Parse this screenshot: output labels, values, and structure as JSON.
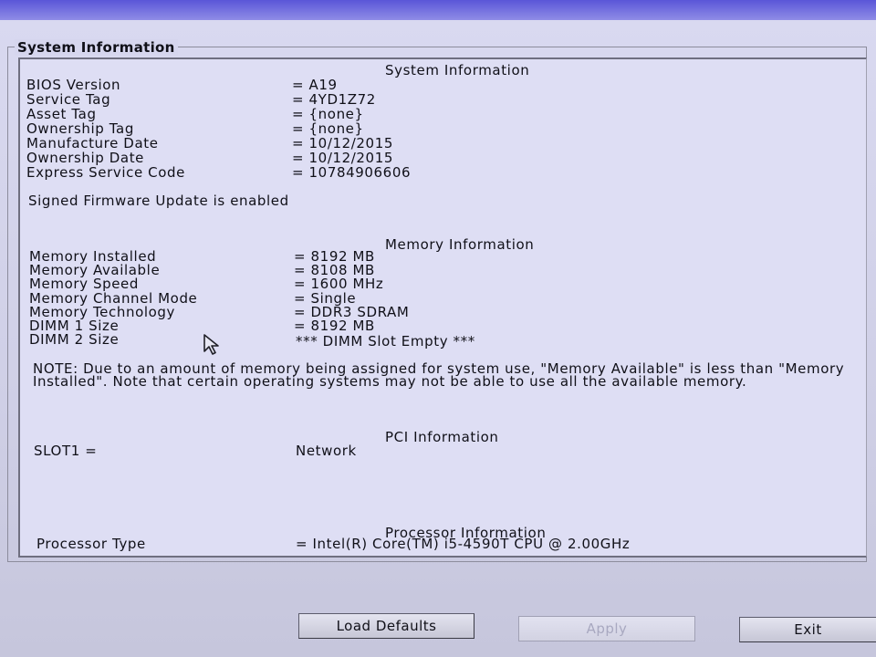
{
  "group_title": "System Information",
  "sections": {
    "system": {
      "header": "System Information",
      "rows": [
        {
          "label": "BIOS Version",
          "value": "= A19"
        },
        {
          "label": "Service Tag",
          "value": "= 4YD1Z72"
        },
        {
          "label": "Asset Tag",
          "value": "= {none}"
        },
        {
          "label": "Ownership Tag",
          "value": "= {none}"
        },
        {
          "label": "Manufacture Date",
          "value": "= 10/12/2015"
        },
        {
          "label": "Ownership Date",
          "value": "= 10/12/2015"
        },
        {
          "label": "Express Service Code",
          "value": "= 10784906606"
        }
      ],
      "status": "Signed Firmware Update is enabled"
    },
    "memory": {
      "header": "Memory Information",
      "rows": [
        {
          "label": "Memory Installed",
          "value": "= 8192 MB"
        },
        {
          "label": "Memory Available",
          "value": "= 8108 MB"
        },
        {
          "label": "Memory Speed",
          "value": "= 1600 MHz"
        },
        {
          "label": "Memory Channel Mode",
          "value": "= Single"
        },
        {
          "label": "Memory Technology",
          "value": "= DDR3 SDRAM"
        },
        {
          "label": "DIMM 1 Size",
          "value": "= 8192 MB"
        },
        {
          "label": "DIMM 2 Size",
          "value": "*** DIMM Slot Empty ***"
        }
      ],
      "note": "NOTE: Due to an amount of memory being assigned for system use, \"Memory Available\" is less than \"Memory Installed\". Note that certain operating systems may not be able to use all the available memory."
    },
    "pci": {
      "header": "PCI Information",
      "rows": [
        {
          "label": "SLOT1 =",
          "value": "Network"
        }
      ]
    },
    "processor": {
      "header": "Processor Information",
      "rows": [
        {
          "label": "Processor Type",
          "value": "= Intel(R) Core(TM) i5-4590T CPU @ 2.00GHz"
        }
      ]
    }
  },
  "buttons": {
    "load_defaults": "Load Defaults",
    "apply": "Apply",
    "exit": "Exit"
  },
  "colors": {
    "top_band": "#5a56d8",
    "background": "#d3d3e8",
    "disabled_text": "#a8a8c0"
  }
}
